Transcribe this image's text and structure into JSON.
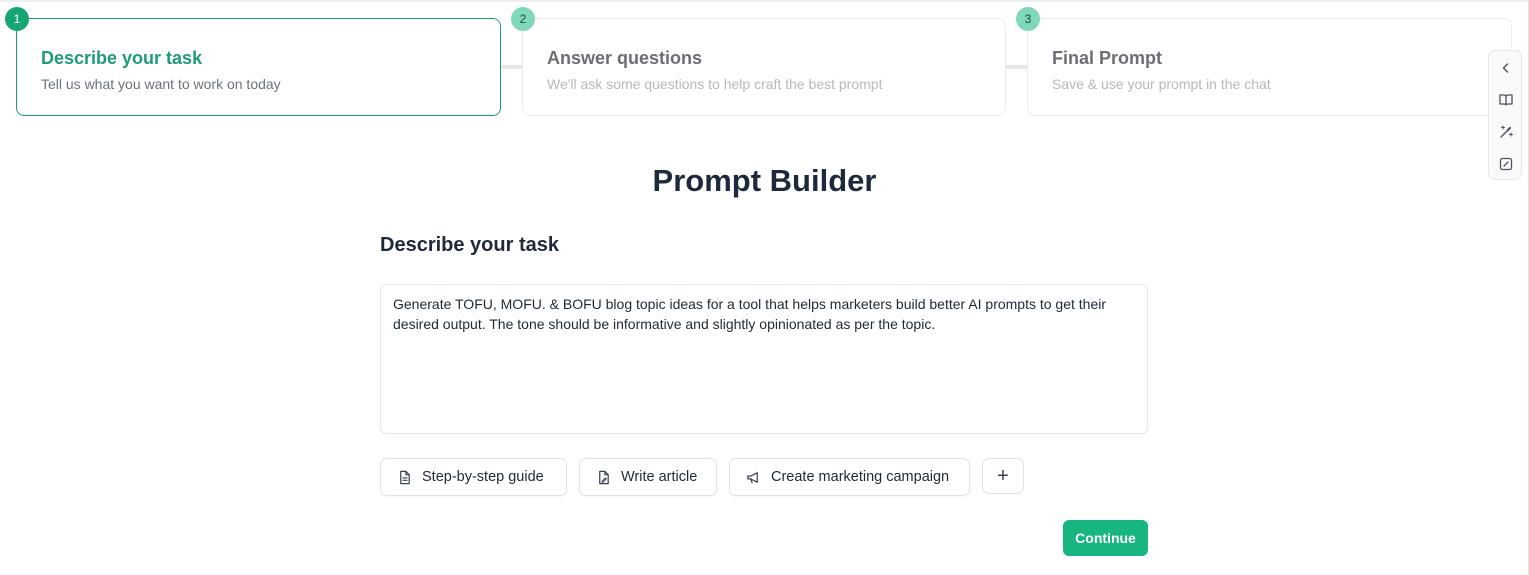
{
  "stepper": {
    "steps": [
      {
        "number": "1",
        "title": "Describe your task",
        "description": "Tell us what you want to work on today"
      },
      {
        "number": "2",
        "title": "Answer questions",
        "description": "We'll ask some questions to help craft the best prompt"
      },
      {
        "number": "3",
        "title": "Final Prompt",
        "description": "Save & use your prompt in the chat"
      }
    ]
  },
  "side_toolbar": {
    "icons": [
      "chevron-left-icon",
      "book-open-icon",
      "magic-wand-icon",
      "edit-square-icon"
    ]
  },
  "main": {
    "title": "Prompt Builder",
    "section_title": "Describe your task",
    "task_value": "Generate TOFU, MOFU. & BOFU blog topic ideas for a tool that helps marketers build better AI prompts to get their desired output. The tone should be informative and slightly opinionated as per the topic.",
    "suggestions": [
      {
        "label": "Step-by-step guide",
        "icon": "document-icon"
      },
      {
        "label": "Write article",
        "icon": "file-edit-icon"
      },
      {
        "label": "Create marketing campaign",
        "icon": "megaphone-icon"
      }
    ],
    "add_label": "+",
    "continue_label": "Continue"
  },
  "colors": {
    "accent": "#1f9b7a",
    "step_active": "#16a673",
    "step_inactive": "#7fd9b9",
    "continue_button": "#17b57f",
    "heading": "#1e293b"
  }
}
